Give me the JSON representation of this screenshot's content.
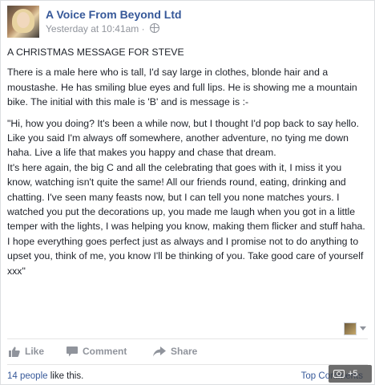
{
  "post": {
    "page_name": "A Voice From Beyond Ltd",
    "timestamp": "Yesterday at 10:41am",
    "separator": "·",
    "title": "A CHRISTMAS MESSAGE FOR STEVE",
    "paragraphs": [
      "There is a male here who is tall, I'd say large in clothes, blonde hair and a moustashe. He has smiling blue eyes and full lips. He is showing me a mountain bike. The initial with this male is 'B' and is message is :-",
      "\"Hi, how you doing? It's been a while now, but I thought I'd pop back to say hello. Like you said I'm always off somewhere, another adventure, no tying me down haha. Live a life that makes you happy and chase that dream.",
      "It's here again, the big C and all the celebrating that goes with it, I miss it you know, watching isn't quite the same! All our friends round, eating, drinking and chatting. I've seen many feasts now, but I can tell you none matches yours. I watched you put the decorations up, you made me laugh when you got in a little temper with the lights, I was helping you know, making them flicker and stuff haha.",
      "I hope everything goes perfect just as always and I promise not to do anything to upset you, think of me, you know I'll be thinking of you. Take good care of yourself xxx\""
    ]
  },
  "actions": {
    "like_label": "Like",
    "comment_label": "Comment",
    "share_label": "Share"
  },
  "stats": {
    "likes_count": "14 people",
    "likes_suffix": " like this.",
    "top_comments": "Top Comments"
  },
  "photo_badge": {
    "count": "+5"
  },
  "colors": {
    "link_blue": "#365899",
    "muted_gray": "#90949c",
    "text": "#1d2129"
  }
}
